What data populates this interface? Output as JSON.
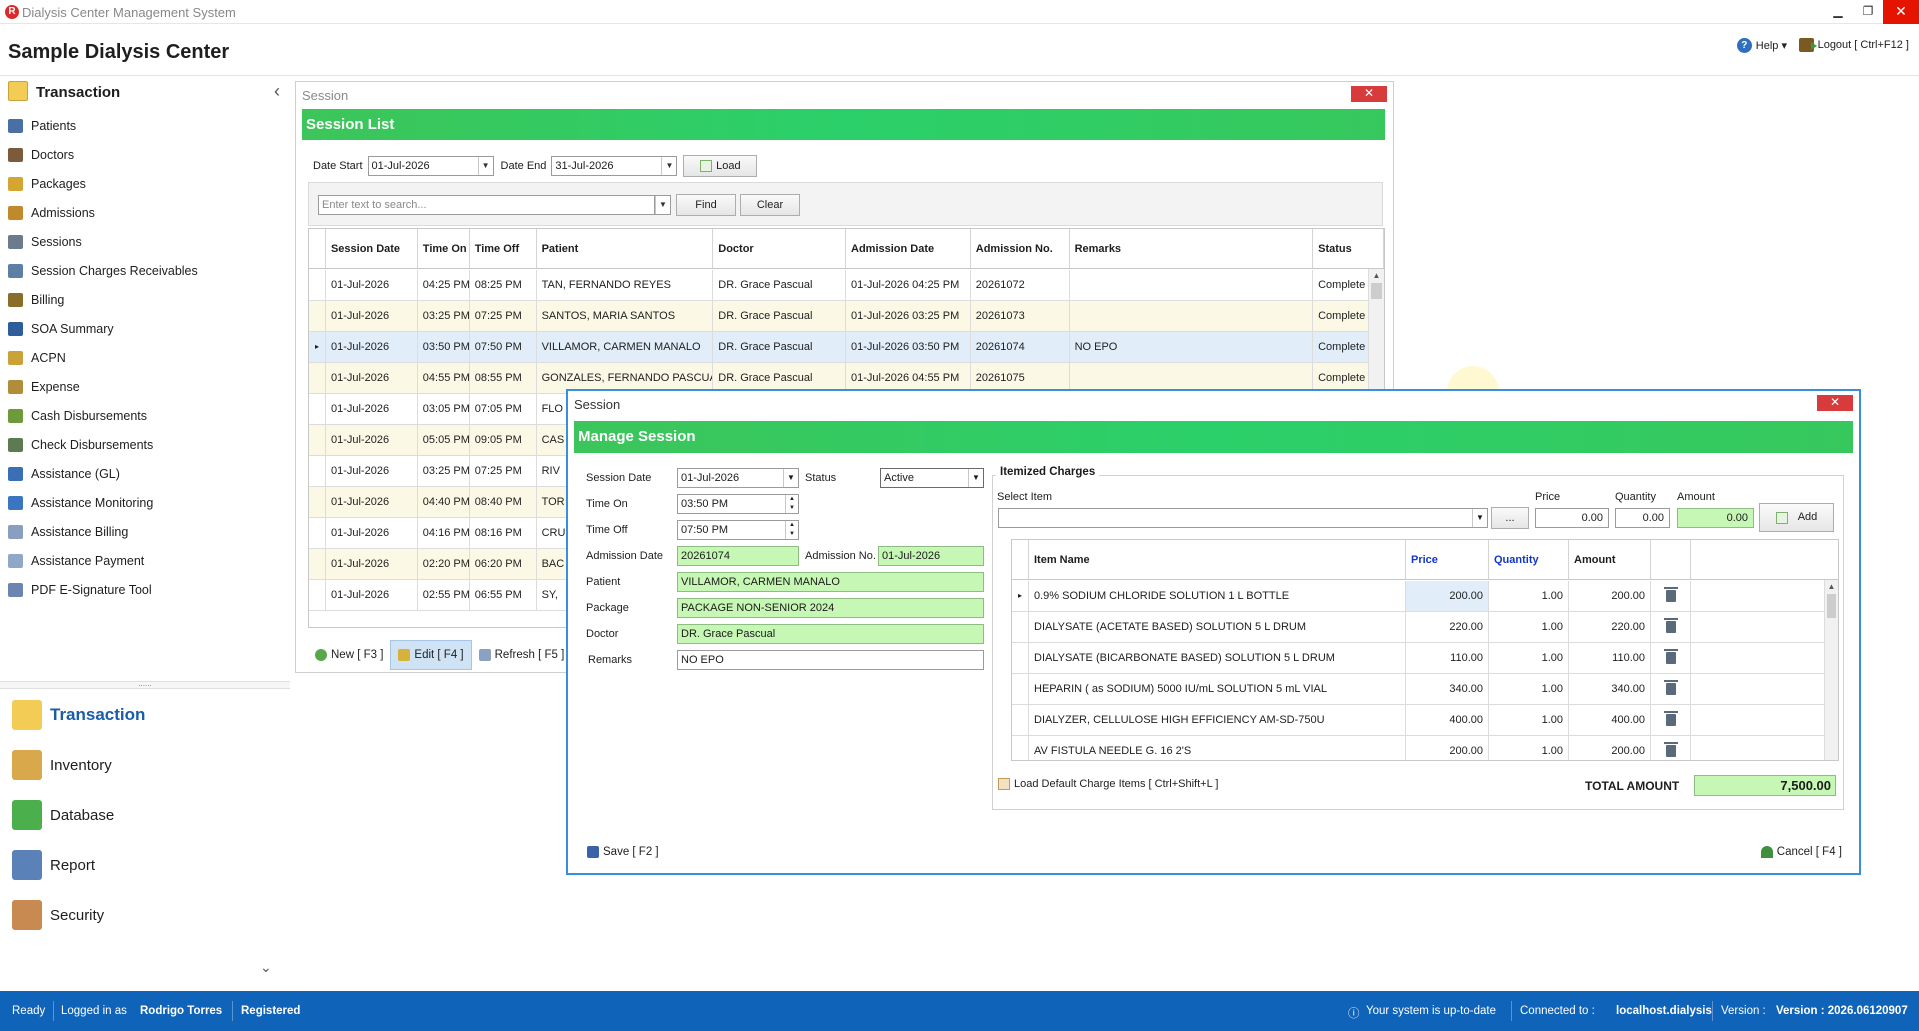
{
  "window": {
    "title": "Dialysis Center Management System",
    "min": "▁",
    "restore": "❐",
    "close": "✕"
  },
  "header": {
    "center_name": "Sample Dialysis Center",
    "help": "Help ▾",
    "logout": "Logout [ Ctrl+F12 ]"
  },
  "sidebar": {
    "title": "Transaction",
    "collapse_glyph": "‹",
    "items": [
      {
        "label": "Patients",
        "icon": "patients-icon",
        "color": "#4a6fa5"
      },
      {
        "label": "Doctors",
        "icon": "doctors-icon",
        "color": "#7c5a3c"
      },
      {
        "label": "Packages",
        "icon": "packages-icon",
        "color": "#d4a531"
      },
      {
        "label": "Admissions",
        "icon": "admissions-icon",
        "color": "#c08a2c"
      },
      {
        "label": "Sessions",
        "icon": "sessions-icon",
        "color": "#6b7b8c"
      },
      {
        "label": "Session Charges Receivables",
        "icon": "receivables-icon",
        "color": "#5d7fa3"
      },
      {
        "label": "Billing",
        "icon": "billing-icon",
        "color": "#8a6d2a"
      },
      {
        "label": "SOA Summary",
        "icon": "soa-icon",
        "color": "#2f5c9a"
      },
      {
        "label": "ACPN",
        "icon": "acpn-icon",
        "color": "#c9a23a"
      },
      {
        "label": "Expense",
        "icon": "expense-icon",
        "color": "#b08d3a"
      },
      {
        "label": "Cash Disbursements",
        "icon": "cash-icon",
        "color": "#6e9a3b"
      },
      {
        "label": "Check Disbursements",
        "icon": "check-icon",
        "color": "#5e7a52"
      },
      {
        "label": "Assistance (GL)",
        "icon": "assistance-gl-icon",
        "color": "#3a6fb8"
      },
      {
        "label": "Assistance Monitoring",
        "icon": "monitoring-icon",
        "color": "#3b74bf"
      },
      {
        "label": "Assistance Billing",
        "icon": "assistance-billing-icon",
        "color": "#8a9fc0"
      },
      {
        "label": "Assistance Payment",
        "icon": "assistance-payment-icon",
        "color": "#8fa7c8"
      },
      {
        "label": "PDF E-Signature Tool",
        "icon": "pdf-signature-icon",
        "color": "#6a86b0"
      }
    ],
    "splitter": "......",
    "groups": [
      {
        "label": "Transaction",
        "icon": "transaction-folder-icon",
        "color": "#f2cc55",
        "active": true
      },
      {
        "label": "Inventory",
        "icon": "inventory-icon",
        "color": "#d9a84a"
      },
      {
        "label": "Database",
        "icon": "database-icon",
        "color": "#4bb04b"
      },
      {
        "label": "Report",
        "icon": "report-icon",
        "color": "#5b82b8"
      },
      {
        "label": "Security",
        "icon": "security-icon",
        "color": "#c98a52"
      }
    ],
    "more": "⌄"
  },
  "session_list": {
    "window_title": "Session",
    "close_glyph": "✕",
    "heading": "Session List",
    "date_start_label": "Date Start",
    "date_start": "01-Jul-2026",
    "date_end_label": "Date End",
    "date_end": "31-Jul-2026",
    "load": "Load",
    "search_placeholder": "Enter text to search...",
    "find": "Find",
    "clear": "Clear",
    "columns": [
      "Session Date",
      "Time On",
      "Time Off",
      "Patient",
      "Doctor",
      "Admission Date",
      "Admission No.",
      "Remarks",
      "Status"
    ],
    "rows": [
      [
        "01-Jul-2026",
        "04:25 PM",
        "08:25 PM",
        "TAN, FERNANDO REYES",
        "DR. Grace Pascual",
        "01-Jul-2026 04:25 PM",
        "20261072",
        "",
        "Complete"
      ],
      [
        "01-Jul-2026",
        "03:25 PM",
        "07:25 PM",
        "SANTOS, MARIA SANTOS",
        "DR. Grace Pascual",
        "01-Jul-2026 03:25 PM",
        "20261073",
        "",
        "Complete"
      ],
      [
        "01-Jul-2026",
        "03:50 PM",
        "07:50 PM",
        "VILLAMOR, CARMEN MANALO",
        "DR. Grace Pascual",
        "01-Jul-2026 03:50 PM",
        "20261074",
        "NO EPO",
        "Complete"
      ],
      [
        "01-Jul-2026",
        "04:55 PM",
        "08:55 PM",
        "GONZALES, FERNANDO PASCUAL",
        "DR. Grace Pascual",
        "01-Jul-2026 04:55 PM",
        "20261075",
        "",
        "Complete"
      ],
      [
        "01-Jul-2026",
        "03:05 PM",
        "07:05 PM",
        "FLO",
        "",
        "",
        "",
        "",
        ""
      ],
      [
        "01-Jul-2026",
        "05:05 PM",
        "09:05 PM",
        "CAS",
        "",
        "",
        "",
        "",
        ""
      ],
      [
        "01-Jul-2026",
        "03:25 PM",
        "07:25 PM",
        "RIV",
        "",
        "",
        "",
        "",
        ""
      ],
      [
        "01-Jul-2026",
        "04:40 PM",
        "08:40 PM",
        "TOR",
        "",
        "",
        "",
        "",
        ""
      ],
      [
        "01-Jul-2026",
        "04:16 PM",
        "08:16 PM",
        "CRU",
        "",
        "",
        "",
        "",
        ""
      ],
      [
        "01-Jul-2026",
        "02:20 PM",
        "06:20 PM",
        "BAC",
        "",
        "",
        "",
        "",
        ""
      ],
      [
        "01-Jul-2026",
        "02:55 PM",
        "06:55 PM",
        "SY,",
        "",
        "",
        "",
        "",
        ""
      ]
    ],
    "toolbar": {
      "new": "New [ F3 ]",
      "edit": "Edit [ F4 ]",
      "refresh": "Refresh [ F5 ]"
    }
  },
  "manage_session": {
    "window_title": "Session",
    "close_glyph": "✕",
    "heading": "Manage Session",
    "labels": {
      "session_date": "Session Date",
      "status": "Status",
      "time_on": "Time On",
      "time_off": "Time Off",
      "admission_date": "Admission Date",
      "admission_no": "Admission No.",
      "patient": "Patient",
      "package": "Package",
      "doctor": "Doctor",
      "remarks": "Remarks"
    },
    "values": {
      "session_date": "01-Jul-2026",
      "status": "Active",
      "time_on": "03:50 PM",
      "time_off": "07:50 PM",
      "admission_date": "20261074",
      "admission_no": "01-Jul-2026",
      "patient": "VILLAMOR, CARMEN MANALO",
      "package": "PACKAGE NON-SENIOR 2024",
      "doctor": "DR. Grace Pascual",
      "remarks": "NO EPO"
    },
    "charges": {
      "title": "Itemized Charges",
      "select_item_label": "Select Item",
      "select_item_value": "",
      "browse": "...",
      "price_label": "Price",
      "price": "0.00",
      "quantity_label": "Quantity",
      "quantity": "0.00",
      "amount_label": "Amount",
      "amount": "0.00",
      "add": "Add",
      "columns": [
        "Item Name",
        "Price",
        "Quantity",
        "Amount"
      ],
      "rows": [
        [
          "0.9% SODIUM CHLORIDE SOLUTION 1 L BOTTLE",
          "200.00",
          "1.00",
          "200.00"
        ],
        [
          "DIALYSATE (ACETATE BASED) SOLUTION 5 L DRUM",
          "220.00",
          "1.00",
          "220.00"
        ],
        [
          "DIALYSATE (BICARBONATE BASED) SOLUTION 5 L DRUM",
          "110.00",
          "1.00",
          "110.00"
        ],
        [
          "HEPARIN ( as SODIUM) 5000 IU/mL SOLUTION 5 mL VIAL",
          "340.00",
          "1.00",
          "340.00"
        ],
        [
          "DIALYZER, CELLULOSE HIGH EFFICIENCY AM-SD-750U",
          "400.00",
          "1.00",
          "400.00"
        ],
        [
          "AV FISTULA NEEDLE G. 16 2'S",
          "200.00",
          "1.00",
          "200.00"
        ]
      ],
      "load_default": "Load Default Charge Items [ Ctrl+Shift+L ]",
      "total_label": "TOTAL AMOUNT",
      "total": "7,500.00"
    },
    "save": "Save [ F2 ]",
    "cancel": "Cancel [ F4 ]"
  },
  "statusbar": {
    "ready": "Ready",
    "logged_in_label": "Logged in as",
    "user": "Rodrigo Torres",
    "registered": "Registered",
    "update_status": "Your system is up-to-date",
    "connected_label": "Connected to :",
    "server": "localhost.dialysis",
    "version_label": "Version :",
    "version": "Version : 2026.06120907"
  },
  "colors": {
    "accent_green": "#37c85d",
    "status_blue": "#0f63b9",
    "field_green": "#c6f7b4",
    "close_red": "#d83b3b"
  }
}
